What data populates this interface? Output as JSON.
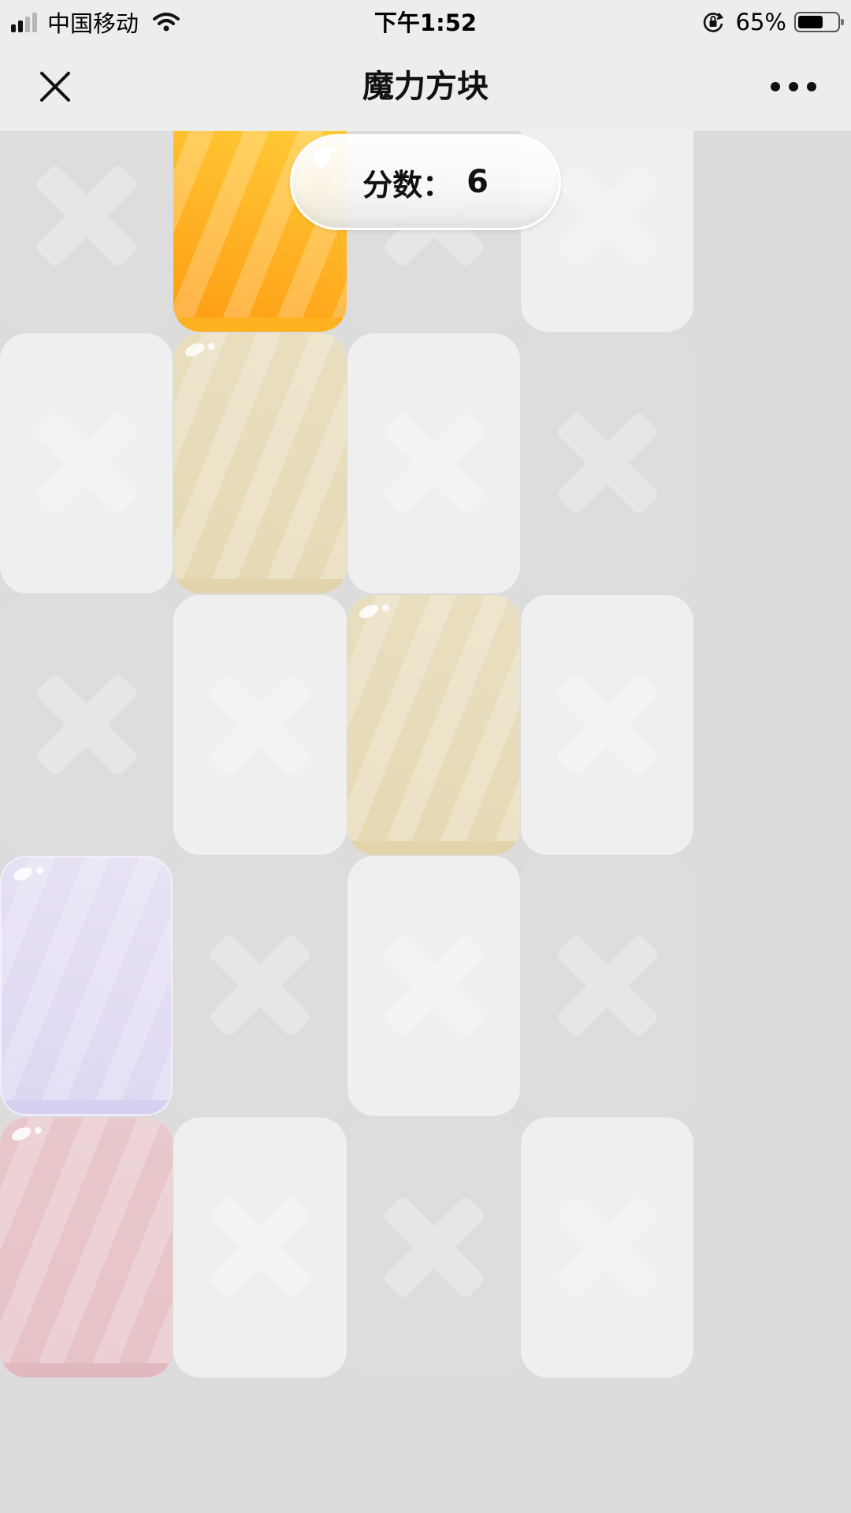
{
  "status_bar": {
    "carrier": "中国移动",
    "time": "下午1:52",
    "battery_percent": "65%",
    "battery_level": 0.65,
    "signal_bars_active": 2,
    "signal_bars_total": 4
  },
  "nav": {
    "title": "魔力方块",
    "close_icon": "close-icon",
    "more_icon": "more-dots-icon"
  },
  "score": {
    "label": "分数：",
    "value": "6"
  },
  "board": {
    "columns": 4,
    "rows_visible": 5,
    "cells": [
      [
        "dark",
        "dark",
        "dark",
        "light"
      ],
      [
        "light",
        "dark",
        "light",
        "dark"
      ],
      [
        "dark",
        "light",
        "dark",
        "light"
      ],
      [
        "dark",
        "dark",
        "light",
        "dark"
      ],
      [
        "dark",
        "light",
        "dark",
        "light"
      ]
    ],
    "tiles": [
      {
        "row": 0,
        "col": 1,
        "color": "orange",
        "state": "active"
      },
      {
        "row": 1,
        "col": 1,
        "color": "cream",
        "state": "faded"
      },
      {
        "row": 2,
        "col": 2,
        "color": "cream",
        "state": "faded"
      },
      {
        "row": 3,
        "col": 0,
        "color": "lavender",
        "state": "faded"
      },
      {
        "row": 4,
        "col": 0,
        "color": "pink",
        "state": "faded"
      }
    ]
  },
  "colors": {
    "orange": "#ffb21f",
    "orange_dark": "#ff9a12",
    "cream": "#e8dfc0",
    "lavender": "#e4dcf2",
    "pink": "#e8c8cc",
    "light_cell": "#efefef",
    "dark_cell": "#dddddd"
  }
}
